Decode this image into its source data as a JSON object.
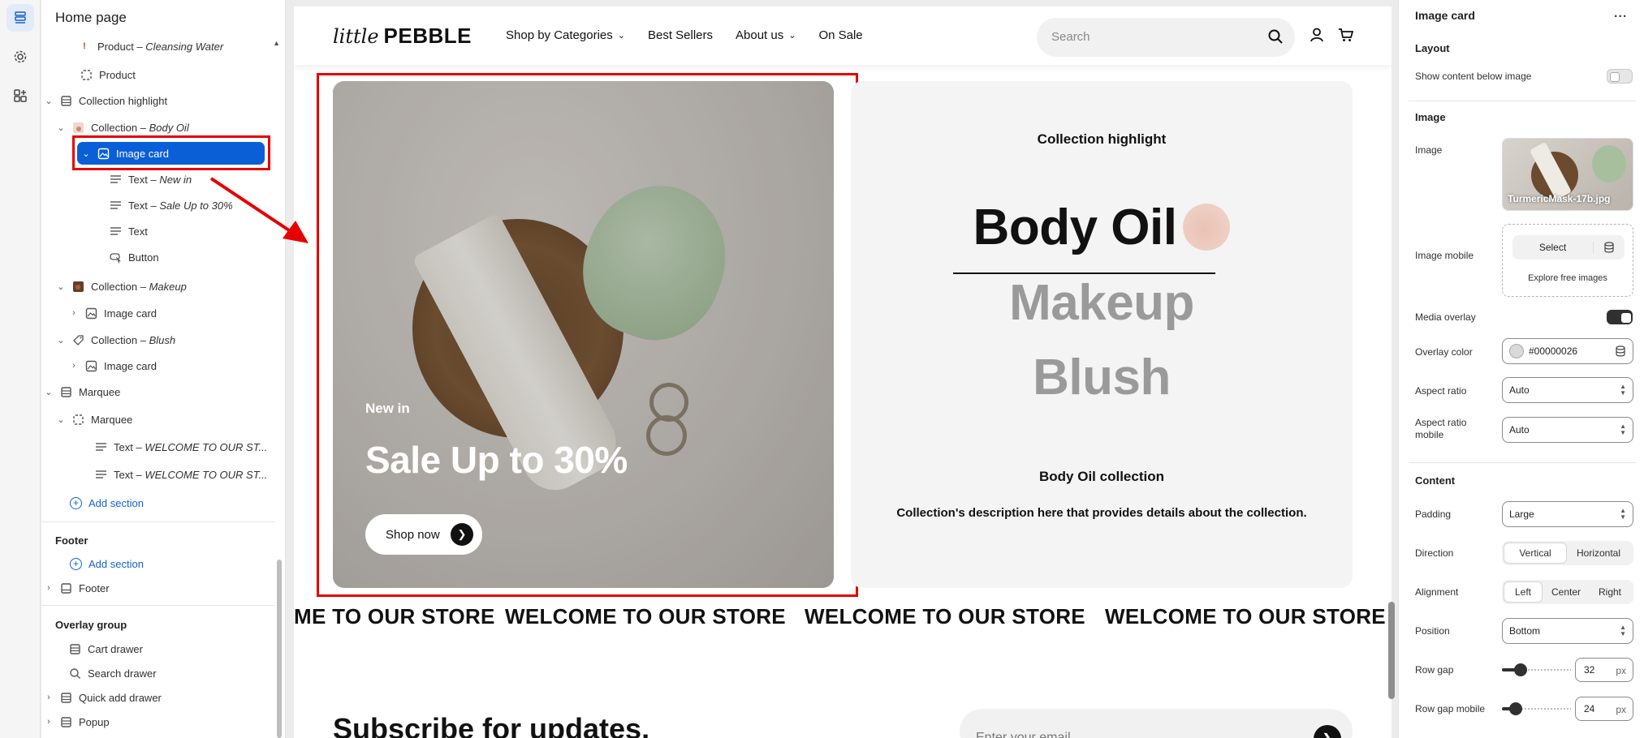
{
  "left_panel": {
    "title": "Home page",
    "tree": [
      {
        "label": "Product",
        "italic": "Cleansing Water",
        "icon": "product-warning-icon"
      },
      {
        "label": "Product",
        "italic": "",
        "icon": "dashed-square-icon"
      },
      {
        "label": "Collection highlight",
        "italic": "",
        "icon": "section-icon"
      },
      {
        "label": "Collection",
        "italic": "Body Oil",
        "icon": "collection-thumb-icon"
      },
      {
        "label": "Image card",
        "italic": "",
        "icon": "image-icon"
      },
      {
        "label": "Text",
        "italic": "New in",
        "icon": "text-lines-icon"
      },
      {
        "label": "Text",
        "italic": "Sale Up to 30%",
        "icon": "text-lines-icon"
      },
      {
        "label": "Text",
        "italic": "",
        "icon": "text-lines-icon"
      },
      {
        "label": "Button",
        "italic": "",
        "icon": "button-cursor-icon"
      },
      {
        "label": "Collection",
        "italic": "Makeup",
        "icon": "collection-thumb-icon"
      },
      {
        "label": "Image card",
        "italic": "",
        "icon": "image-icon"
      },
      {
        "label": "Collection",
        "italic": "Blush",
        "icon": "tag-icon"
      },
      {
        "label": "Image card",
        "italic": "",
        "icon": "image-icon"
      },
      {
        "label": "Marquee",
        "italic": "",
        "icon": "section-icon"
      },
      {
        "label": "Marquee",
        "italic": "",
        "icon": "dashed-square-icon"
      },
      {
        "label": "Text",
        "italic": "WELCOME TO OUR ST...",
        "icon": "text-lines-icon"
      },
      {
        "label": "Text",
        "italic": "WELCOME TO OUR ST...",
        "icon": "text-lines-icon"
      }
    ],
    "add_section": "Add section",
    "footer_group": "Footer",
    "footer_add_section": "Add section",
    "footer_item": "Footer",
    "overlay_group": "Overlay group",
    "overlay_items": [
      "Cart drawer",
      "Search drawer",
      "Quick add drawer",
      "Popup"
    ],
    "dash": "–"
  },
  "store": {
    "logo_little": "little",
    "logo_brand": "PEBBLE",
    "nav": [
      "Shop by Categories",
      "Best Sellers",
      "About us",
      "On Sale"
    ],
    "search_placeholder": "Search",
    "image_card": {
      "subheading": "New in",
      "heading": "Sale Up to 30%",
      "button": "Shop now"
    },
    "collection_highlight": {
      "title": "Collection highlight",
      "collections": [
        "Body Oil",
        "Makeup",
        "Blush"
      ],
      "active_collection": "Body Oil",
      "collection_name": "Body Oil collection",
      "description": "Collection's description here that provides details about the collection."
    },
    "marquee": [
      "ME TO OUR STORE",
      "WELCOME TO OUR STORE",
      "WELCOME TO OUR STORE",
      "WELCOME TO OUR STORE"
    ],
    "subscribe_title": "Subscribe for updates.",
    "email_placeholder": "Enter your email"
  },
  "settings": {
    "title": "Image card",
    "more": "...",
    "layout": {
      "section": "Layout",
      "show_content_below_image": {
        "label": "Show content below image",
        "value": false
      }
    },
    "image": {
      "section": "Image",
      "image_label": "Image",
      "image_file": "TurmericMask-17b.jpg",
      "image_mobile_label": "Image mobile",
      "select": "Select",
      "explore": "Explore free images",
      "media_overlay": {
        "label": "Media overlay",
        "value": true
      },
      "overlay_color": {
        "label": "Overlay color",
        "value": "#00000026"
      },
      "aspect_ratio": {
        "label": "Aspect ratio",
        "value": "Auto"
      },
      "aspect_ratio_mobile": {
        "label": "Aspect ratio mobile",
        "value": "Auto"
      }
    },
    "content": {
      "section": "Content",
      "padding": {
        "label": "Padding",
        "value": "Large"
      },
      "direction": {
        "label": "Direction",
        "options": [
          "Vertical",
          "Horizontal"
        ],
        "selected": "Vertical"
      },
      "alignment": {
        "label": "Alignment",
        "options": [
          "Left",
          "Center",
          "Right"
        ],
        "selected": "Left"
      },
      "position": {
        "label": "Position",
        "value": "Bottom"
      },
      "row_gap": {
        "label": "Row gap",
        "value": "32",
        "unit": "px",
        "level": 0.27
      },
      "row_gap_mobile": {
        "label": "Row gap mobile",
        "value": "24",
        "unit": "px",
        "level": 0.2
      }
    }
  },
  "colors": {
    "accent_blue": "#0b5fd6",
    "highlight_red": "#e60000",
    "link_blue": "#1560d4"
  }
}
